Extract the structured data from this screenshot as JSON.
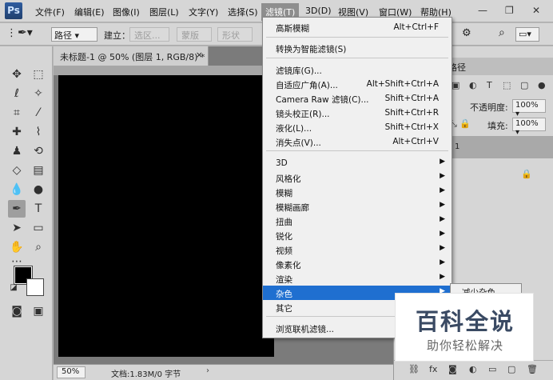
{
  "app": {
    "logo": "Ps"
  },
  "menubar": {
    "items": [
      "文件(F)",
      "编辑(E)",
      "图像(I)",
      "图层(L)",
      "文字(Y)",
      "选择(S)",
      "滤镜(T)",
      "3D(D)",
      "视图(V)",
      "窗口(W)",
      "帮助(H)"
    ],
    "active": "滤镜(T)"
  },
  "options_bar": {
    "mode_select": "路径",
    "build_label": "建立：",
    "selection_btn": "选区...",
    "mask_btn": "蒙版",
    "shape_btn": "形状"
  },
  "document": {
    "tab_title": "未标题-1 @ 50% (图层 1, RGB/8) *",
    "zoom": "50%",
    "info": "文档:1.83M/0 字节",
    "canvas_color": "#000000"
  },
  "colors": {
    "foreground": "#000000",
    "background": "#ffffff",
    "highlight": "#1f6fd0"
  },
  "filter_menu": {
    "items": [
      {
        "label": "高斯模糊",
        "shortcut": "Alt+Ctrl+F"
      },
      {
        "label": "转换为智能滤镜(S)",
        "shortcut": ""
      },
      {
        "label": "滤镜库(G)...",
        "shortcut": ""
      },
      {
        "label": "自适应广角(A)...",
        "shortcut": "Alt+Shift+Ctrl+A"
      },
      {
        "label": "Camera Raw 滤镜(C)...",
        "shortcut": "Shift+Ctrl+A"
      },
      {
        "label": "镜头校正(R)...",
        "shortcut": "Shift+Ctrl+R"
      },
      {
        "label": "液化(L)...",
        "shortcut": "Shift+Ctrl+X"
      },
      {
        "label": "消失点(V)...",
        "shortcut": "Alt+Ctrl+V"
      },
      {
        "label": "3D",
        "submenu": true
      },
      {
        "label": "风格化",
        "submenu": true
      },
      {
        "label": "模糊",
        "submenu": true
      },
      {
        "label": "模糊画廊",
        "submenu": true
      },
      {
        "label": "扭曲",
        "submenu": true
      },
      {
        "label": "锐化",
        "submenu": true
      },
      {
        "label": "视频",
        "submenu": true
      },
      {
        "label": "像素化",
        "submenu": true
      },
      {
        "label": "渲染",
        "submenu": true
      },
      {
        "label": "杂色",
        "submenu": true,
        "highlighted": true
      },
      {
        "label": "其它",
        "submenu": true
      },
      {
        "label": "浏览联机滤镜...",
        "shortcut": ""
      }
    ],
    "submenu_visible_text": "减少杂色..."
  },
  "panels": {
    "tab_label": "路径",
    "opacity_label": "不透明度:",
    "opacity_value": "100%",
    "fill_label": "填充:",
    "fill_value": "100%",
    "layer_row_text": "1",
    "kind_value": "100%"
  },
  "watermark": {
    "title": "百科全说",
    "subtitle": "助你轻松解决"
  }
}
